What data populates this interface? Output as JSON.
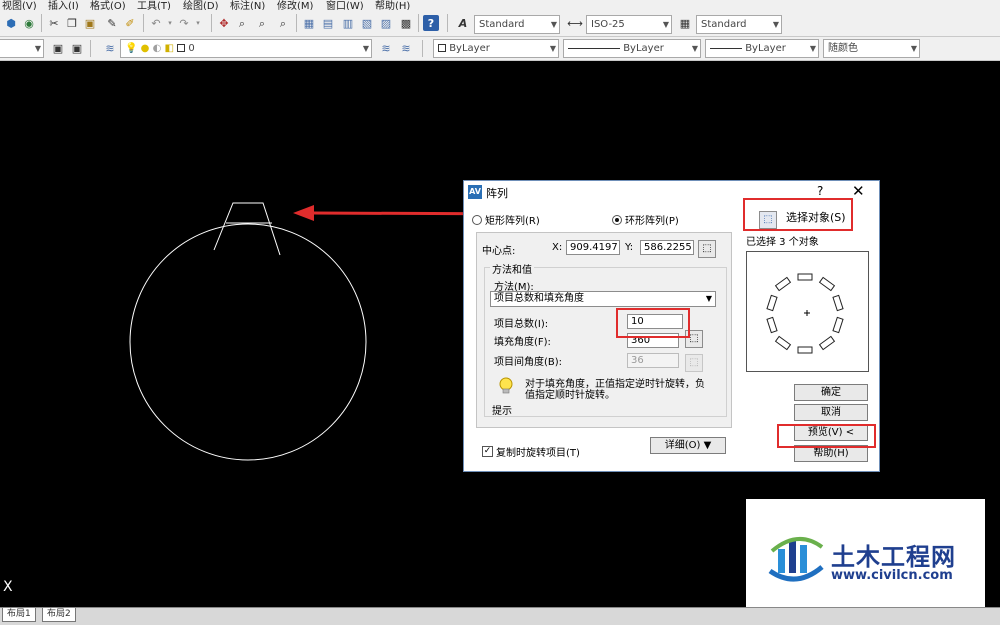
{
  "menu": [
    "视图(V)",
    "插入(I)",
    "格式(O)",
    "工具(T)",
    "绘图(D)",
    "标注(N)",
    "修改(M)",
    "窗口(W)",
    "帮助(H)"
  ],
  "toolbar1": {
    "text_style": "Standard",
    "dim_style": "ISO-25",
    "table_style": "Standard"
  },
  "toolbar2": {
    "layer_name": "0",
    "linetype_layer": "ByLayer",
    "lineweight": "ByLayer",
    "line_color": "ByLayer",
    "plot_style": "随颜色"
  },
  "dialog": {
    "title": "阵列",
    "help_glyph": "?",
    "close_glyph": "✕",
    "radio_rect": "矩形阵列(R)",
    "radio_polar": "环形阵列(P)",
    "polar_selected": true,
    "select_objects_label": "选择对象(S)",
    "selected_count": "已选择 3 个对象",
    "center_label": "中心点:",
    "x_label": "X:",
    "x_value": "909.4197",
    "y_label": "Y:",
    "y_value": "586.2255",
    "method_group": "方法和值",
    "method_label": "方法(M):",
    "method_value": "项目总数和填充角度",
    "total_items_label": "项目总数(I):",
    "total_items_value": "10",
    "fill_angle_label": "填充角度(F):",
    "fill_angle_value": "360",
    "item_angle_label": "项目间角度(B):",
    "item_angle_value": "36",
    "hint_text_1": "对于填充角度，正值指定逆时针旋转，负",
    "hint_text_2": "值指定顺时针旋转。",
    "hint_label": "提示",
    "rotate_label": "复制时旋转项目(T)",
    "rotate_checked": true,
    "details_label": "详细(O)",
    "ok_label": "确定",
    "cancel_label": "取消",
    "preview_label": "预览(V) <",
    "help_label": "帮助(H)"
  },
  "layout_tabs": [
    "布局1",
    "布局2"
  ],
  "coord_glyph": "X",
  "watermark": {
    "title": "土木工程网",
    "url": "www.civilcn.com"
  },
  "colors": {
    "annotation_red": "#e02c2c",
    "canvas": "#000000",
    "drawing_lines": "#ffffff",
    "watermark_blue": "#1f3f8f"
  }
}
